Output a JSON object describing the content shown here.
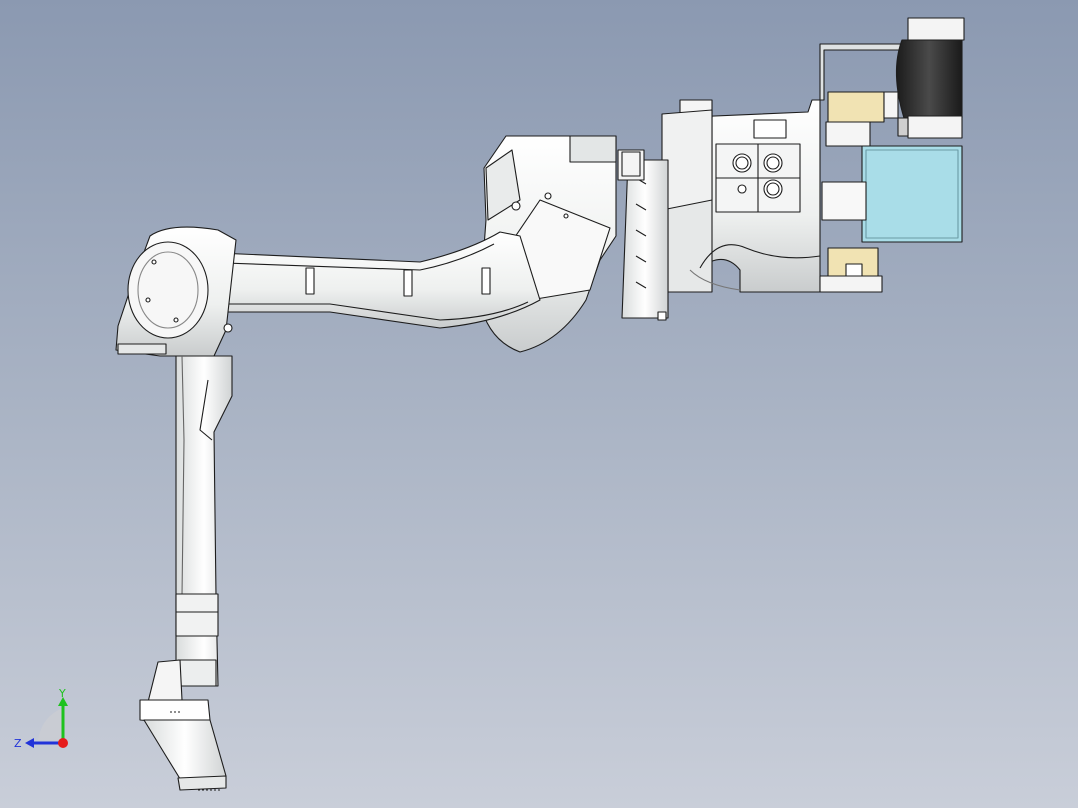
{
  "viewport": {
    "background_top": "#8b99b1",
    "background_bottom": "#c9ced9"
  },
  "model": {
    "body_color": "#f2f3f2",
    "edge_color": "#1d1d1d",
    "shade_color": "#c8cbcc",
    "panel_color": "#a9dde8",
    "motor_color": "#2b2b2b",
    "accent_color": "#f1e3b3"
  },
  "triad": {
    "y_label": "Y",
    "z_label": "Z",
    "y_color": "#1ec21e",
    "z_color": "#2133d9",
    "x_color": "#e61b1b"
  }
}
